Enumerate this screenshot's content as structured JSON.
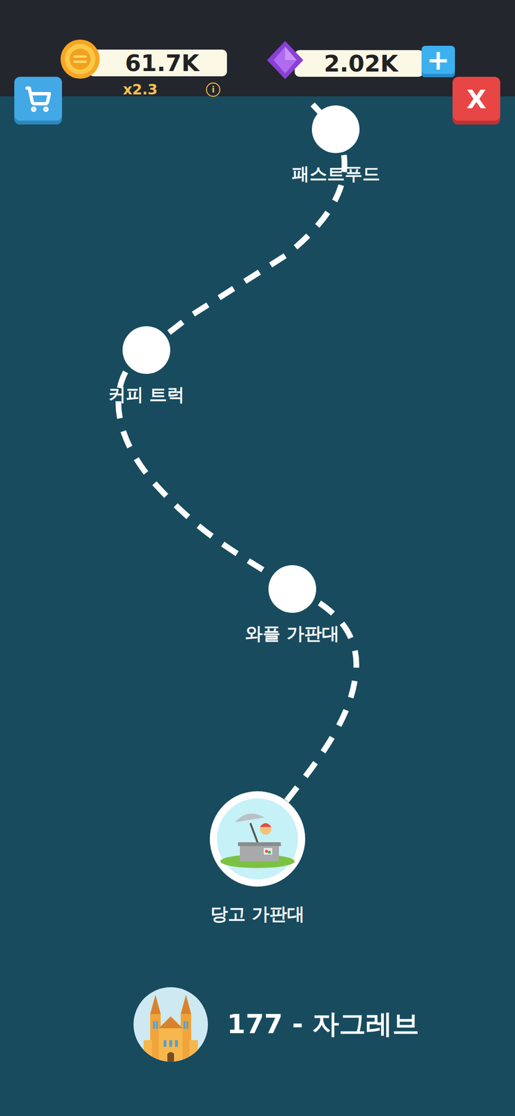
{
  "currency": {
    "coins": "61.7K",
    "multiplier": "x2.3",
    "info": "i",
    "gems": "2.02K",
    "add": "+"
  },
  "buttons": {
    "close": "X"
  },
  "stages": [
    {
      "label": "패스트푸드",
      "unlocked": false,
      "current": false
    },
    {
      "label": "커피 트럭",
      "unlocked": false,
      "current": false
    },
    {
      "label": "와플 가판대",
      "unlocked": false,
      "current": false
    },
    {
      "label": "당고 가판대",
      "unlocked": true,
      "current": true
    }
  ],
  "city": {
    "title": "177 - 자그레브"
  }
}
